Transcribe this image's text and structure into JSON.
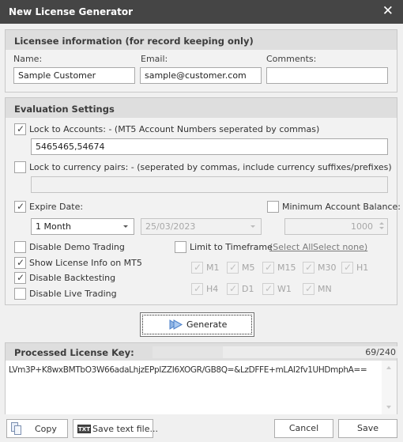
{
  "window": {
    "title": "New License Generator",
    "close_icon": "close-icon"
  },
  "licensee": {
    "header": "Licensee information (for record keeping only)",
    "name_label": "Name:",
    "name_value": "Sample Customer",
    "email_label": "Email:",
    "email_value": "sample@customer.com",
    "comments_label": "Comments:",
    "comments_value": ""
  },
  "evaluation": {
    "header": "Evaluation Settings",
    "lock_accounts": {
      "label": "Lock to Accounts: - (MT5 Account Numbers seperated by commas)",
      "checked": true,
      "value": "5465465,54674"
    },
    "lock_currency": {
      "label": "Lock to currency pairs: - (seperated by commas, include currency suffixes/prefixes)",
      "checked": false,
      "value": ""
    },
    "expire": {
      "label": "Expire Date:",
      "checked": true,
      "period_selected": "1 Month",
      "date_value": "25/03/2023"
    },
    "min_balance": {
      "label": "Minimum Account Balance:",
      "checked": false,
      "value": "1000"
    },
    "options": [
      {
        "label": "Disable Demo Trading",
        "checked": false
      },
      {
        "label": "Show License Info on MT5",
        "checked": true
      },
      {
        "label": "Disable Backtesting",
        "checked": true
      },
      {
        "label": "Disable Live Trading",
        "checked": false
      }
    ],
    "timeframe": {
      "label": "Limit to Timeframe",
      "checked": false,
      "select_all": "(Select All",
      "select_none": "Select none)",
      "items": [
        {
          "label": "M1",
          "checked": true
        },
        {
          "label": "M5",
          "checked": true
        },
        {
          "label": "M15",
          "checked": true
        },
        {
          "label": "M30",
          "checked": true
        },
        {
          "label": "H1",
          "checked": true
        },
        {
          "label": "H4",
          "checked": true
        },
        {
          "label": "D1",
          "checked": true
        },
        {
          "label": "W1",
          "checked": true
        },
        {
          "label": "MN",
          "checked": true
        }
      ]
    }
  },
  "generate": {
    "label": "Generate",
    "icon": "play-arrow-icon"
  },
  "license_key": {
    "header": "Processed License Key:",
    "counter": "69/240",
    "progress_fraction": 0.2875,
    "value": "LVm3P+K8wxBMTbO3W66adaLhjzEPpIZZI6XOGR/GB8Q=&LzDFFE+mLAI2fv1UHDmphA=="
  },
  "footer": {
    "copy_label": "Copy",
    "save_text_label": "Save text file...",
    "save_text_icon_text": "TXT",
    "cancel_label": "Cancel",
    "save_label": "Save"
  },
  "colors": {
    "titlebar": "#454545",
    "accent_icon": "#4a7fc9"
  }
}
